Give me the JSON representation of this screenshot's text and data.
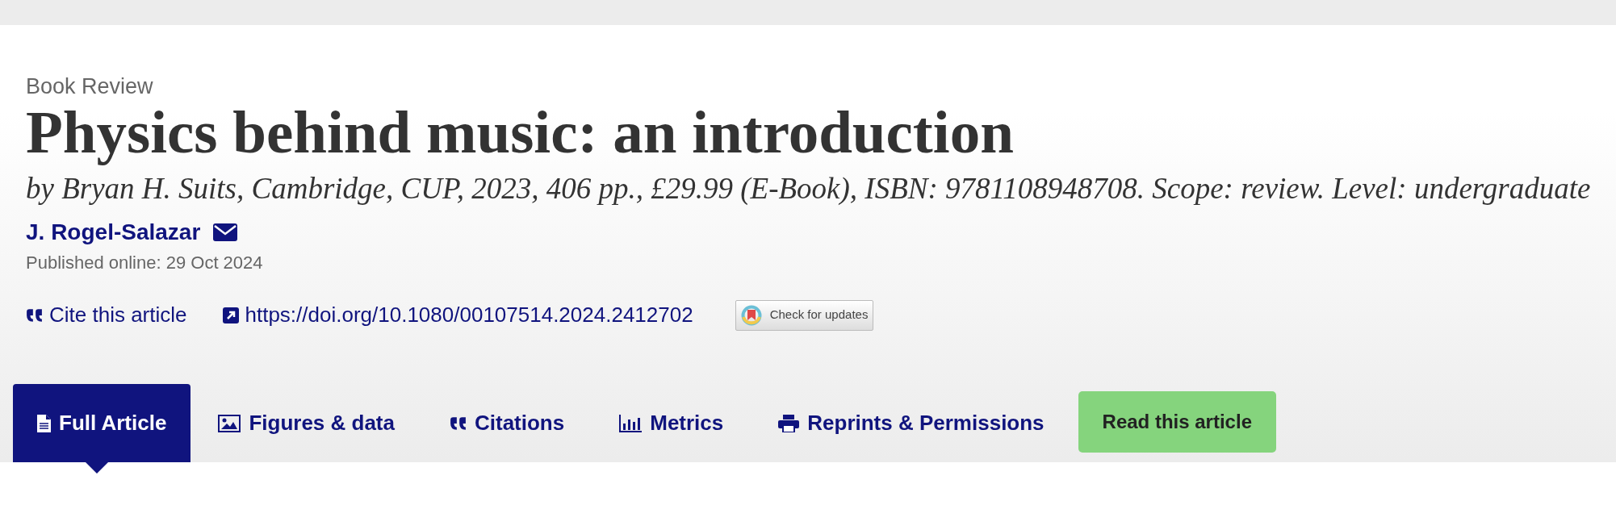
{
  "article": {
    "type_label": "Book Review",
    "title": "Physics behind music: an introduction",
    "subtitle": "by Bryan H. Suits, Cambridge, CUP, 2023, 406 pp., £29.99 (E-Book), ISBN: 9781108948708. Scope: review. Level: undergraduate",
    "author": "J. Rogel-Salazar",
    "published": "Published online: 29 Oct 2024"
  },
  "links": [
    {
      "kind": "cite",
      "label": "Cite this article"
    },
    {
      "kind": "doi",
      "label": "https://doi.org/10.1080/00107514.2024.2412702"
    }
  ],
  "update_button": "Check for updates",
  "tabs": [
    {
      "kind": "document",
      "label": "Full Article",
      "selected": true
    },
    {
      "kind": "image",
      "label": "Figures & data",
      "selected": false
    },
    {
      "kind": "quote",
      "label": "Citations",
      "selected": false
    },
    {
      "kind": "chart",
      "label": "Metrics",
      "selected": false
    },
    {
      "kind": "printer",
      "label": "Reprints & Permissions",
      "selected": false
    }
  ],
  "read_button": "Read this article"
}
